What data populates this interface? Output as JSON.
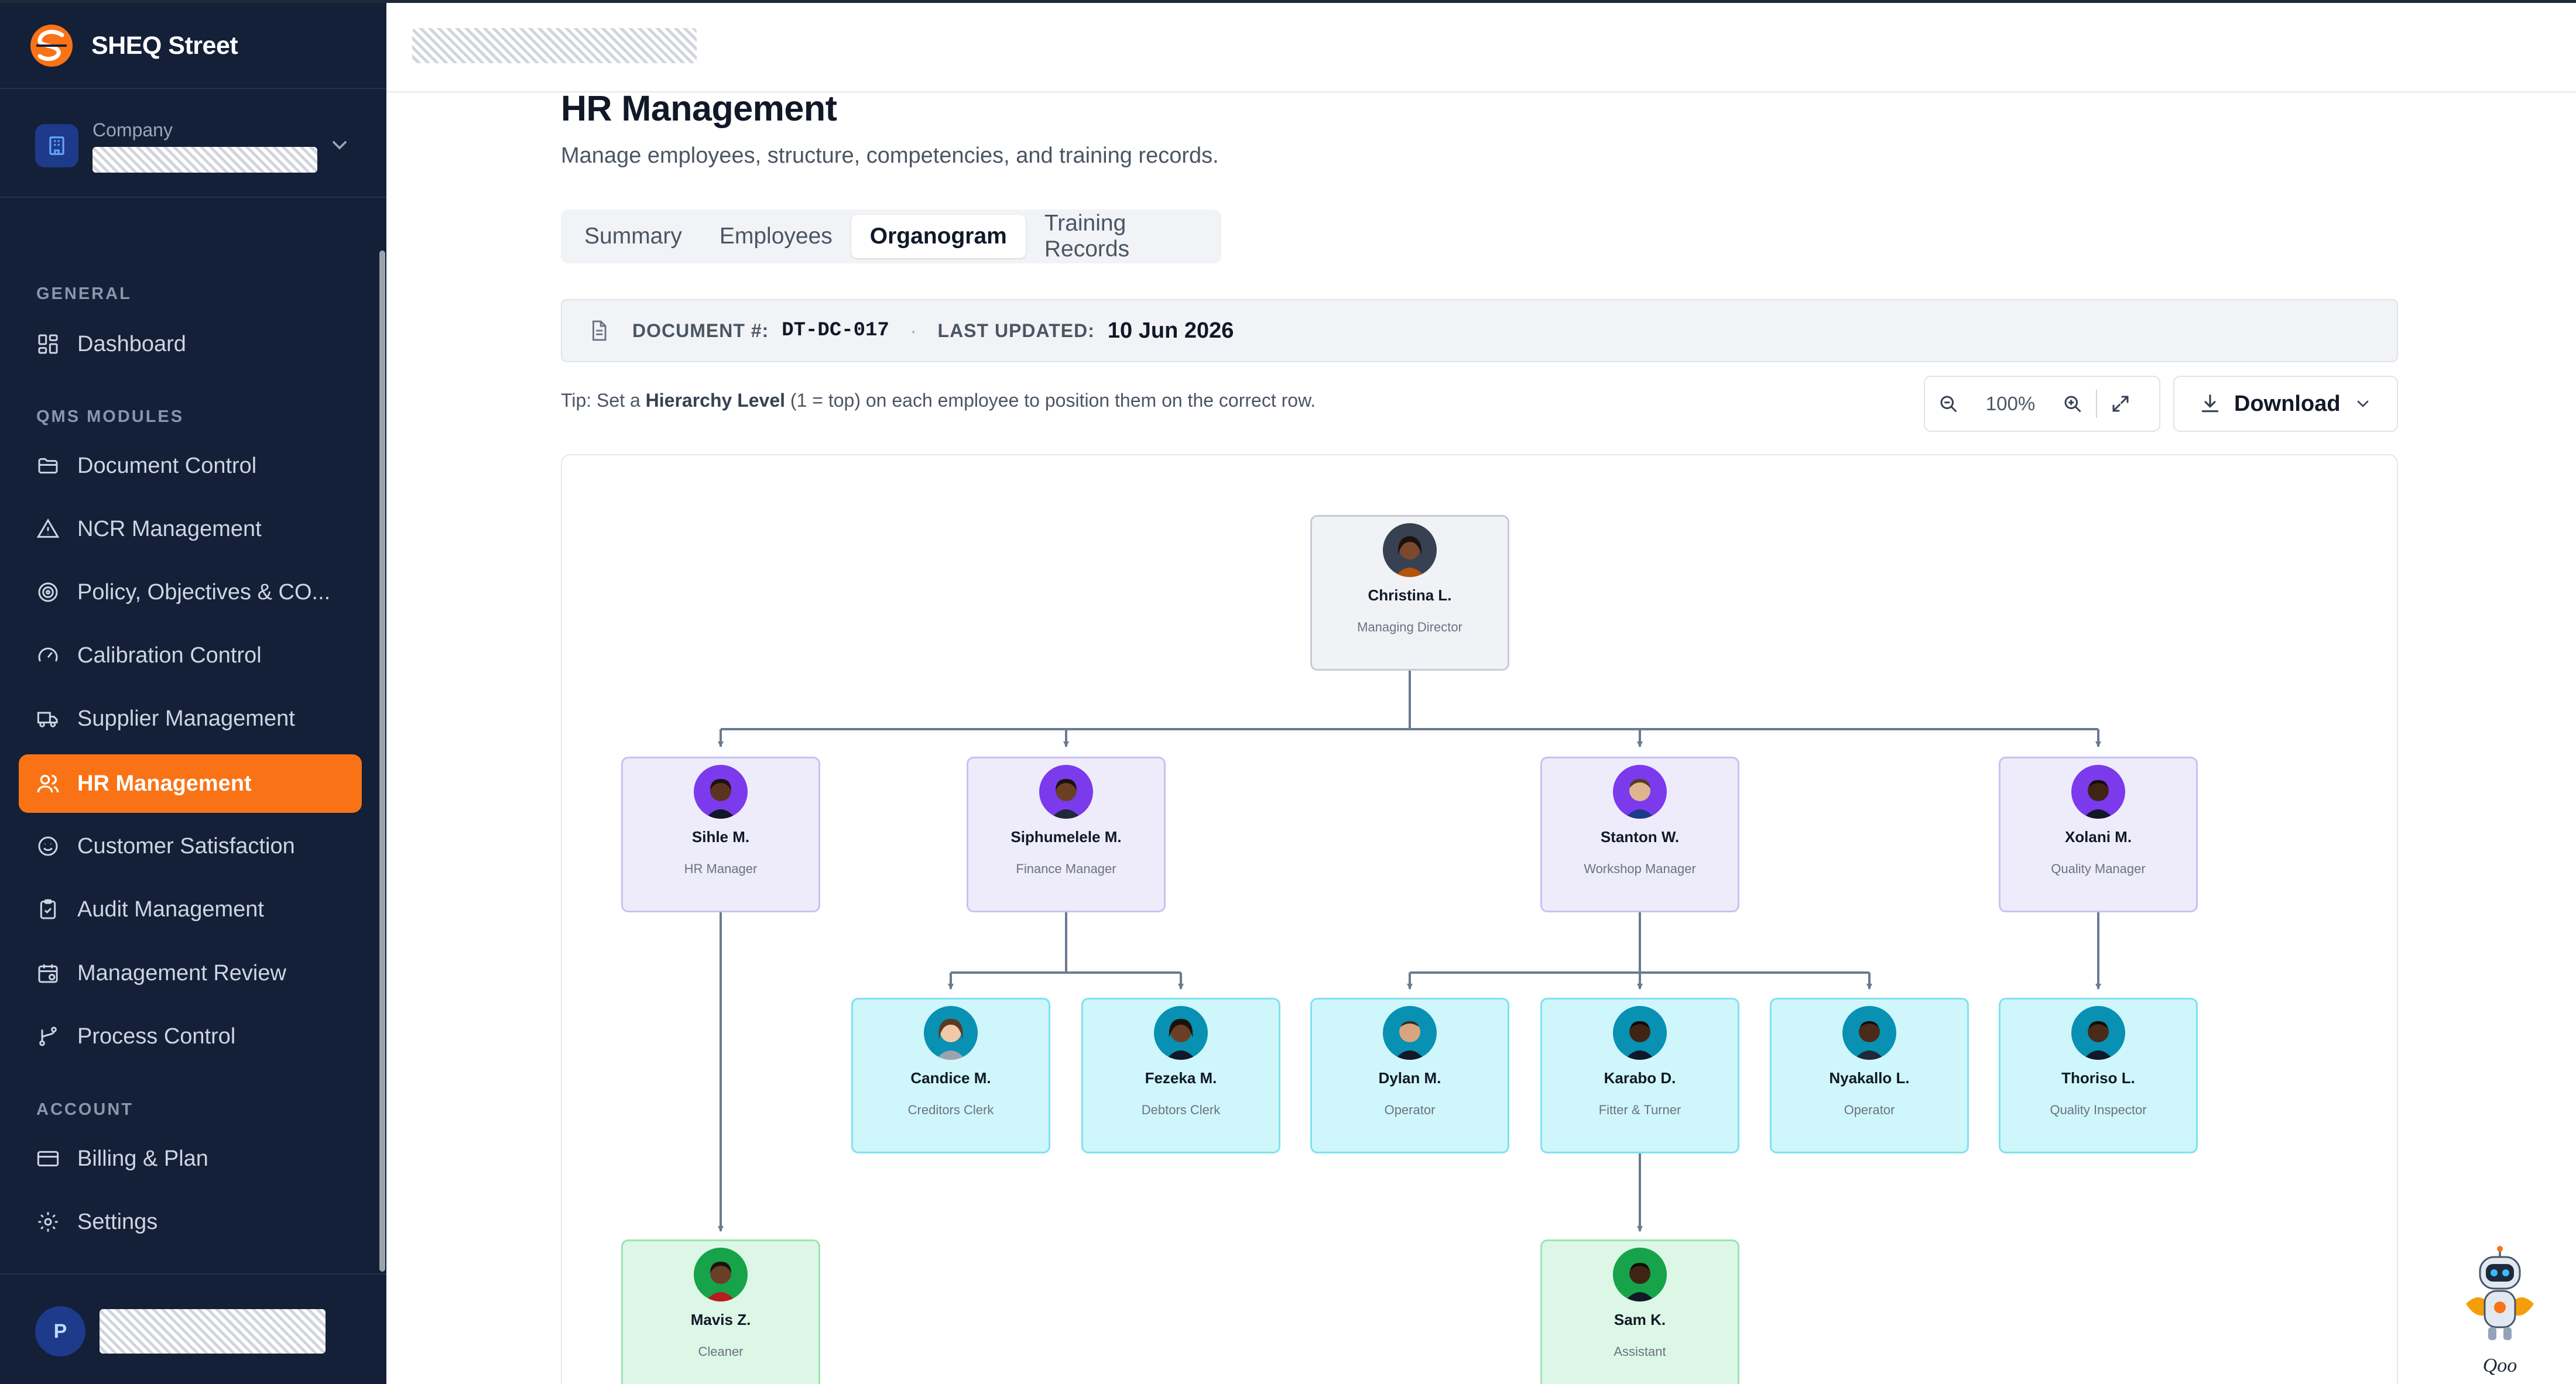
{
  "app": {
    "name": "SHEQ Street"
  },
  "company": {
    "label": "Company"
  },
  "sidebar": {
    "sections": {
      "general": "GENERAL",
      "qms": "QMS MODULES",
      "account": "ACCOUNT"
    },
    "items": [
      {
        "label": "Dashboard",
        "icon": "dashboard-icon"
      },
      {
        "label": "Document Control",
        "icon": "folder-icon"
      },
      {
        "label": "NCR Management",
        "icon": "warning-triangle-icon"
      },
      {
        "label": "Policy, Objectives & CO...",
        "icon": "target-icon"
      },
      {
        "label": "Calibration Control",
        "icon": "gauge-icon"
      },
      {
        "label": "Supplier Management",
        "icon": "truck-icon"
      },
      {
        "label": "HR Management",
        "icon": "users-icon",
        "active": true
      },
      {
        "label": "Customer Satisfaction",
        "icon": "smile-icon"
      },
      {
        "label": "Audit Management",
        "icon": "clipboard-icon"
      },
      {
        "label": "Management Review",
        "icon": "calendar-icon"
      },
      {
        "label": "Process Control",
        "icon": "git-branch-icon"
      },
      {
        "label": "Billing & Plan",
        "icon": "credit-card-icon"
      },
      {
        "label": "Settings",
        "icon": "gear-icon"
      }
    ],
    "user": {
      "initial": "P"
    }
  },
  "page": {
    "title": "HR Management",
    "subtitle": "Manage employees, structure, competencies, and training records.",
    "tabs": [
      "Summary",
      "Employees",
      "Organogram",
      "Training Records"
    ],
    "active_tab": "Organogram"
  },
  "document": {
    "number_label": "DOCUMENT #:",
    "number": "DT-DC-017",
    "updated_label": "LAST UPDATED:",
    "updated": "10 Jun 2026"
  },
  "tip": {
    "prefix": "Tip: Set a ",
    "bold": "Hierarchy Level",
    "suffix": " (1 = top) on each employee to position them on the correct row."
  },
  "toolbar": {
    "zoom": "100%",
    "download": "Download"
  },
  "org": [
    {
      "name": "Christina L.",
      "role": "Managing Director"
    },
    {
      "name": "Sihle M.",
      "role": "HR Manager"
    },
    {
      "name": "Siphumelele M.",
      "role": "Finance Manager"
    },
    {
      "name": "Stanton W.",
      "role": "Workshop Manager"
    },
    {
      "name": "Xolani M.",
      "role": "Quality Manager"
    },
    {
      "name": "Candice M.",
      "role": "Creditors Clerk"
    },
    {
      "name": "Fezeka M.",
      "role": "Debtors Clerk"
    },
    {
      "name": "Dylan M.",
      "role": "Operator"
    },
    {
      "name": "Karabo D.",
      "role": "Fitter & Turner"
    },
    {
      "name": "Nyakallo L.",
      "role": "Operator"
    },
    {
      "name": "Thoriso L.",
      "role": "Quality Inspector"
    },
    {
      "name": "Mavis Z.",
      "role": "Cleaner"
    },
    {
      "name": "Sam K.",
      "role": "Assistant"
    }
  ],
  "assistant": {
    "name": "Qoo"
  }
}
